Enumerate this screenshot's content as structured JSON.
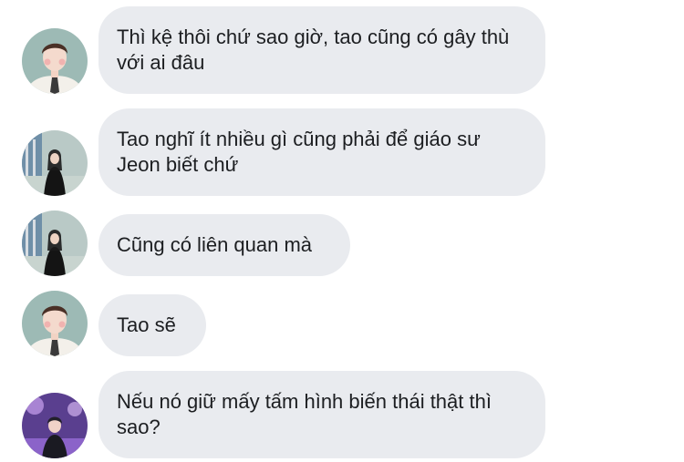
{
  "thread": {
    "messages": [
      {
        "sender_avatar": "young-man-avatar",
        "text": "Thì kệ thôi chứ sao giờ, tao cũng có gây thù với ai đâu"
      },
      {
        "sender_avatar": "woman-black-dress-avatar",
        "text": "Tao nghĩ ít nhiều gì cũng phải để giáo sư Jeon biết chứ"
      },
      {
        "sender_avatar": "woman-black-dress-avatar",
        "text": "Cũng có liên quan mà"
      },
      {
        "sender_avatar": "young-man-avatar",
        "text": "Tao sẽ"
      },
      {
        "sender_avatar": "purple-stage-avatar",
        "text": "Nếu nó giữ mấy tấm hình biến thái thật thì sao?"
      }
    ]
  },
  "colors": {
    "bubble_background": "#e9ebef",
    "text": "#1c1e21",
    "page_background": "#ffffff"
  }
}
